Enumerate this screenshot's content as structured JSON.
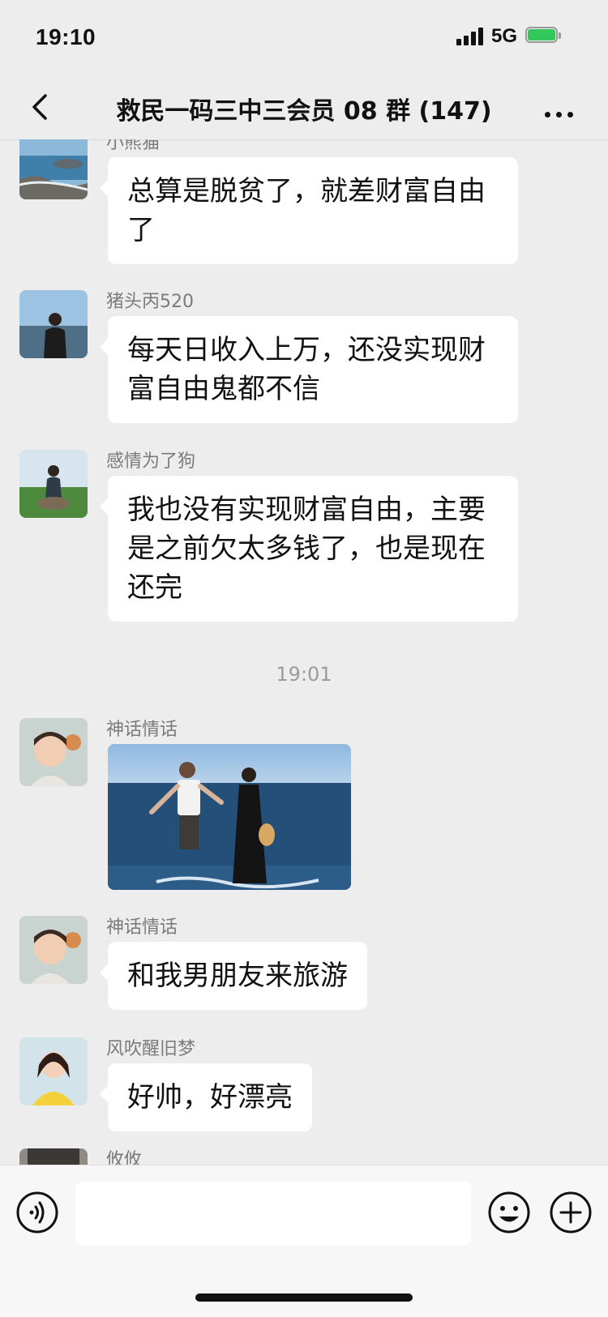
{
  "status_bar": {
    "time": "19:10",
    "network": "5G"
  },
  "header": {
    "title": "救民一码三中三会员 08 群 (147)"
  },
  "messages": [
    {
      "sender": "小熊猫",
      "text": "总算是脱贫了，就差财富自由了"
    },
    {
      "sender": "猪头丙520",
      "text": "每天日收入上万，还没实现财富自由鬼都不信"
    },
    {
      "sender": "感情为了狗",
      "text": "我也没有实现财富自由，主要是之前欠太多钱了，也是现在还完"
    },
    {
      "sender": "神话情话",
      "type": "image"
    },
    {
      "sender": "神话情话",
      "text": "和我男朋友来旅游"
    },
    {
      "sender": "风吹醒旧梦",
      "text": "好帅，好漂亮"
    },
    {
      "sender": "攸攸"
    }
  ],
  "timestamp": "19:01",
  "icons": {
    "back": "chevron-left-icon",
    "more": "more-dots-icon",
    "voice": "voice-icon",
    "emoji": "emoji-icon",
    "plus": "plus-icon"
  },
  "colors": {
    "background": "#ededed",
    "bubble": "#ffffff",
    "battery": "#34c759",
    "sender_text": "#7b7b7b"
  }
}
